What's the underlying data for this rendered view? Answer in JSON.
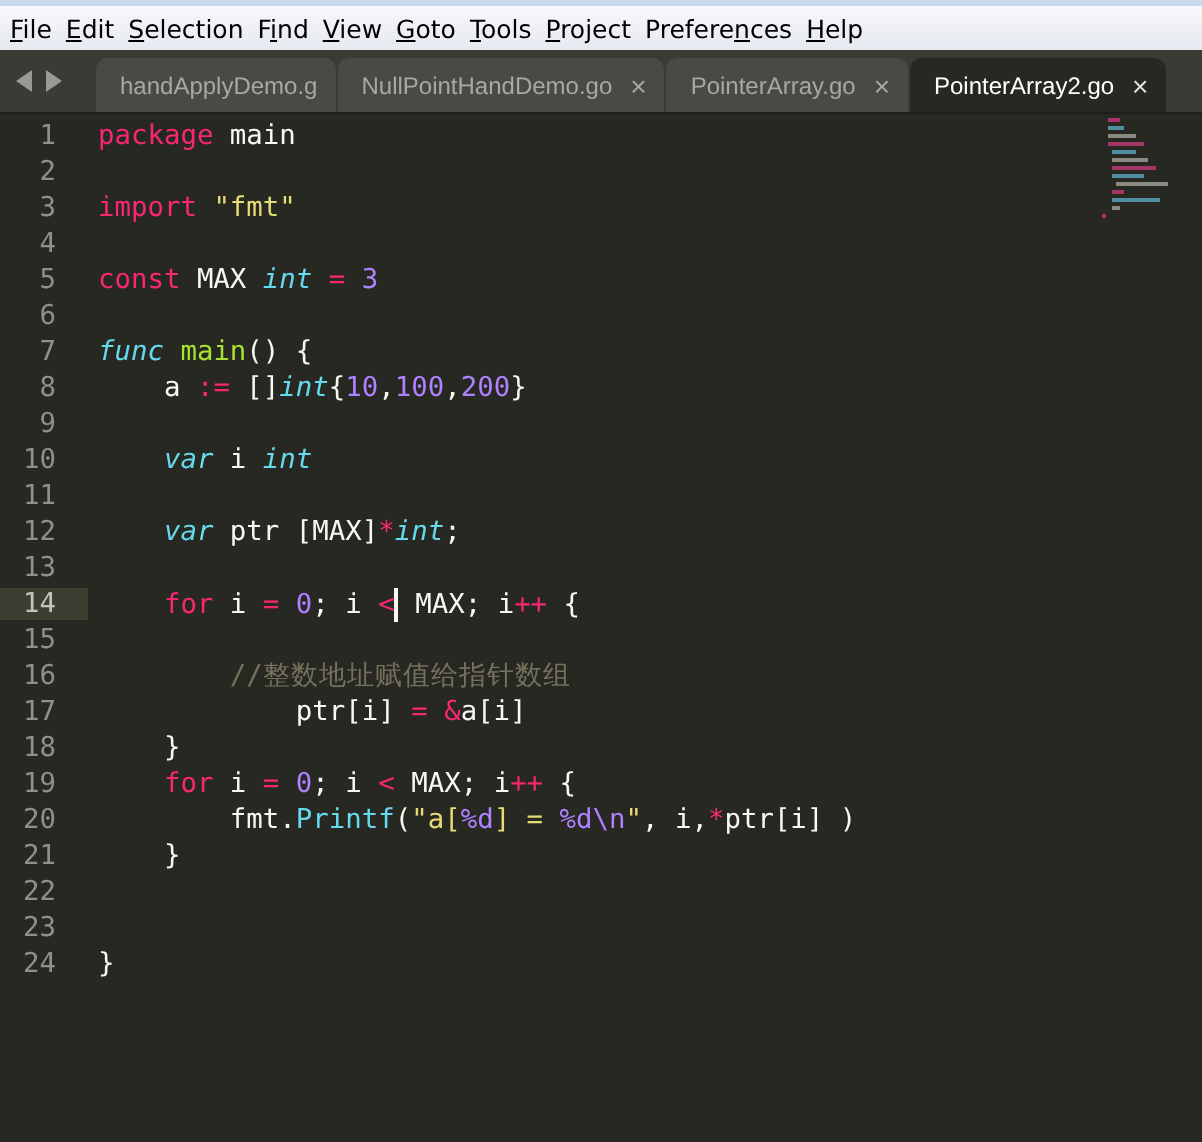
{
  "menu": [
    {
      "key": "F",
      "post": "ile"
    },
    {
      "key": "E",
      "post": "dit"
    },
    {
      "key": "S",
      "post": "election"
    },
    {
      "pre": "F",
      "key": "i",
      "post": "nd"
    },
    {
      "key": "V",
      "post": "iew"
    },
    {
      "key": "G",
      "post": "oto"
    },
    {
      "key": "T",
      "post": "ools"
    },
    {
      "key": "P",
      "post": "roject"
    },
    {
      "pre": "Prefere",
      "key": "n",
      "post": "ces"
    },
    {
      "key": "H",
      "post": "elp"
    }
  ],
  "tabs": [
    {
      "label": "handApplyDemo.g",
      "selected": false
    },
    {
      "label": "NullPointHandDemo.go",
      "close": "×",
      "selected": false
    },
    {
      "label": "PointerArray.go",
      "close": "×",
      "selected": false
    },
    {
      "label": "PointerArray2.go",
      "close": "×",
      "selected": true
    }
  ],
  "lines": [
    {
      "number": "1",
      "current": false,
      "tokens": [
        {
          "kind": "kw",
          "text": "package"
        },
        {
          "kind": "plain",
          "text": " main"
        }
      ]
    },
    {
      "number": "2",
      "current": false
    },
    {
      "number": "3",
      "current": false,
      "tokens": [
        {
          "kind": "kw",
          "text": "import"
        },
        {
          "kind": "str",
          "text": " \"fmt\""
        }
      ]
    },
    {
      "number": "4",
      "current": false
    },
    {
      "number": "5",
      "current": false,
      "tokens": [
        {
          "kind": "kw",
          "text": "const"
        },
        {
          "kind": "plain",
          "text": " MAX "
        },
        {
          "kind": "type",
          "text": "int"
        },
        {
          "kind": "op",
          "text": " = "
        },
        {
          "kind": "num",
          "text": "3"
        }
      ]
    },
    {
      "number": "6",
      "current": false
    },
    {
      "number": "7",
      "current": false,
      "tokens": [
        {
          "kind": "type",
          "text": "func"
        },
        {
          "kind": "fn",
          "text": " main"
        },
        {
          "kind": "plain",
          "text": "() {"
        }
      ]
    },
    {
      "number": "8",
      "current": false,
      "tokens": [
        {
          "kind": "plain",
          "text": "    a "
        },
        {
          "kind": "op",
          "text": ":="
        },
        {
          "kind": "plain",
          "text": " []"
        },
        {
          "kind": "type",
          "text": "int"
        },
        {
          "kind": "plain",
          "text": "{"
        },
        {
          "kind": "num",
          "text": "10"
        },
        {
          "kind": "plain",
          "text": ","
        },
        {
          "kind": "num",
          "text": "100"
        },
        {
          "kind": "plain",
          "text": ","
        },
        {
          "kind": "num",
          "text": "200"
        },
        {
          "kind": "plain",
          "text": "}"
        }
      ]
    },
    {
      "number": "9",
      "current": false
    },
    {
      "number": "10",
      "current": false,
      "tokens": [
        {
          "kind": "type",
          "text": "    var"
        },
        {
          "kind": "plain",
          "text": " i "
        },
        {
          "kind": "type",
          "text": "int"
        }
      ]
    },
    {
      "number": "11",
      "current": false
    },
    {
      "number": "12",
      "current": false,
      "tokens": [
        {
          "kind": "type",
          "text": "    var"
        },
        {
          "kind": "plain",
          "text": " ptr [MAX]"
        },
        {
          "kind": "op",
          "text": "*"
        },
        {
          "kind": "type",
          "text": "int"
        },
        {
          "kind": "plain",
          "text": ";"
        }
      ]
    },
    {
      "number": "13",
      "current": false
    },
    {
      "number": "14",
      "current": true,
      "tokens": [
        {
          "kind": "kw",
          "text": "    for"
        },
        {
          "kind": "plain",
          "text": " i "
        },
        {
          "kind": "op",
          "text": "="
        },
        {
          "kind": "num",
          "text": " 0"
        },
        {
          "kind": "plain",
          "text": "; i "
        },
        {
          "kind": "op",
          "text": "<"
        },
        {
          "kind": "caret"
        },
        {
          "kind": "plain",
          "text": " MAX; i"
        },
        {
          "kind": "op",
          "text": "++"
        },
        {
          "kind": "plain",
          "text": " {"
        }
      ]
    },
    {
      "number": "15",
      "current": false
    },
    {
      "number": "16",
      "current": false,
      "tokens": [
        {
          "kind": "comment",
          "text": "        //整数地址赋值给指针数组"
        }
      ]
    },
    {
      "number": "17",
      "current": false,
      "tokens": [
        {
          "kind": "plain",
          "text": "            ptr[i] "
        },
        {
          "kind": "op",
          "text": "="
        },
        {
          "kind": "op",
          "text": " &"
        },
        {
          "kind": "plain",
          "text": "a[i]"
        }
      ]
    },
    {
      "number": "18",
      "current": false,
      "tokens": [
        {
          "kind": "plain",
          "text": "    }"
        }
      ]
    },
    {
      "number": "19",
      "current": false,
      "tokens": [
        {
          "kind": "kw",
          "text": "    for"
        },
        {
          "kind": "plain",
          "text": " i "
        },
        {
          "kind": "op",
          "text": "="
        },
        {
          "kind": "num",
          "text": " 0"
        },
        {
          "kind": "plain",
          "text": "; i "
        },
        {
          "kind": "op",
          "text": "<"
        },
        {
          "kind": "plain",
          "text": " MAX; i"
        },
        {
          "kind": "op",
          "text": "++"
        },
        {
          "kind": "plain",
          "text": " {"
        }
      ]
    },
    {
      "number": "20",
      "current": false,
      "tokens": [
        {
          "kind": "plain",
          "text": "        fmt."
        },
        {
          "kind": "call",
          "text": "Printf"
        },
        {
          "kind": "plain",
          "text": "("
        },
        {
          "kind": "str",
          "text": "\"a["
        },
        {
          "kind": "num",
          "text": "%d"
        },
        {
          "kind": "str",
          "text": "] = "
        },
        {
          "kind": "num",
          "text": "%d\\n"
        },
        {
          "kind": "str",
          "text": "\""
        },
        {
          "kind": "plain",
          "text": ", i,"
        },
        {
          "kind": "op",
          "text": "*"
        },
        {
          "kind": "plain",
          "text": "ptr[i] )"
        }
      ]
    },
    {
      "number": "21",
      "current": false,
      "tokens": [
        {
          "kind": "plain",
          "text": "    }"
        }
      ]
    },
    {
      "number": "22",
      "current": false
    },
    {
      "number": "23",
      "current": false
    },
    {
      "number": "24",
      "current": false,
      "tokens": [
        {
          "kind": "plain",
          "text": "}"
        }
      ]
    }
  ]
}
